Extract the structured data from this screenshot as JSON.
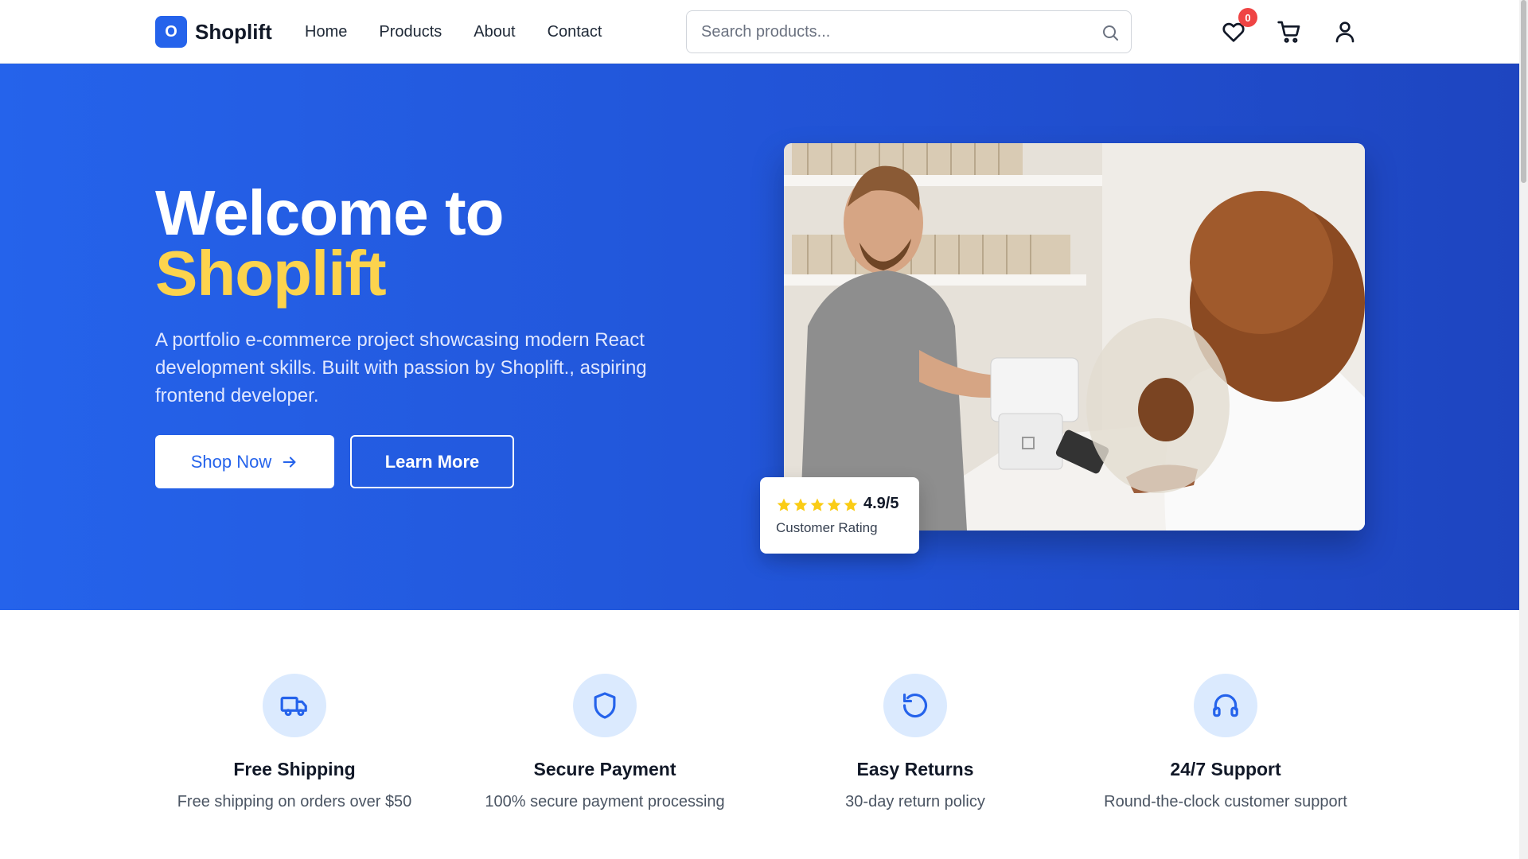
{
  "header": {
    "logo_letter": "O",
    "brand": "Shoplift",
    "nav": [
      "Home",
      "Products",
      "About",
      "Contact"
    ],
    "search_placeholder": "Search products...",
    "wishlist_count": "0"
  },
  "hero": {
    "title_line1": "Welcome to",
    "title_line2": "Shoplift",
    "description": "A portfolio e-commerce project showcasing modern React development skills. Built with passion by Shoplift., aspiring frontend developer.",
    "shop_button": "Shop Now",
    "learn_button": "Learn More",
    "rating_value": "4.9/5",
    "rating_label": "Customer Rating",
    "rating_stars": 5
  },
  "features": [
    {
      "icon": "truck-icon",
      "title": "Free Shipping",
      "desc": "Free shipping on orders over $50"
    },
    {
      "icon": "shield-icon",
      "title": "Secure Payment",
      "desc": "100% secure payment processing"
    },
    {
      "icon": "rotate-icon",
      "title": "Easy Returns",
      "desc": "30-day return policy"
    },
    {
      "icon": "headphones-icon",
      "title": "24/7 Support",
      "desc": "Round-the-clock customer support"
    }
  ],
  "colors": {
    "primary": "#2563eb",
    "accent_yellow": "#fcd34d",
    "badge_red": "#ef4444",
    "feature_circle": "#dbeafe"
  }
}
